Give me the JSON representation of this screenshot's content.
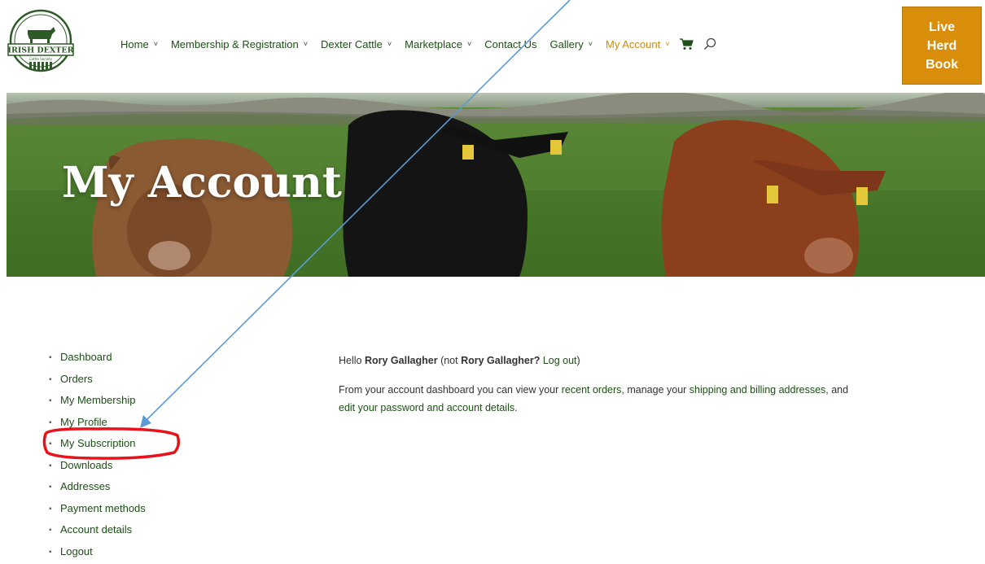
{
  "header": {
    "logo_text": "IRISH DEXTER",
    "logo_sub": "Cattle Society",
    "nav": [
      {
        "label": "Home",
        "has_dropdown": true,
        "active": false
      },
      {
        "label": "Membership & Registration",
        "has_dropdown": true,
        "active": false
      },
      {
        "label": "Dexter Cattle",
        "has_dropdown": true,
        "active": false
      },
      {
        "label": "Marketplace",
        "has_dropdown": true,
        "active": false
      },
      {
        "label": "Contact Us",
        "has_dropdown": false,
        "active": false
      },
      {
        "label": "Gallery",
        "has_dropdown": true,
        "active": false
      },
      {
        "label": "My Account",
        "has_dropdown": true,
        "active": true
      }
    ],
    "live_herd_book": [
      "Live",
      "Herd",
      "Book"
    ]
  },
  "hero": {
    "title": "My Account"
  },
  "account_nav": {
    "items": [
      "Dashboard",
      "Orders",
      "My Membership",
      "My Profile",
      "My Subscription",
      "Downloads",
      "Addresses",
      "Payment methods",
      "Account details",
      "Logout"
    ],
    "highlighted": "My Subscription"
  },
  "content": {
    "greeting_prefix": "Hello ",
    "user_name": "Rory Gallagher",
    "greeting_mid": " (not ",
    "user_name_repeat": "Rory Gallagher? ",
    "logout_link": "Log out",
    "greeting_suffix": ")",
    "dash_part1": "From your account dashboard you can view your ",
    "recent_orders_link": "recent orders",
    "dash_part2": ", manage your ",
    "addresses_link": "shipping and billing addresses",
    "dash_part3": ", and ",
    "account_details_link": "edit your password and account details",
    "dash_part4": "."
  },
  "colors": {
    "nav_green": "#1d4f16",
    "accent_orange": "#d88e0a",
    "annotation_red": "#e8121b",
    "annotation_arrow": "#5b9bd5"
  }
}
